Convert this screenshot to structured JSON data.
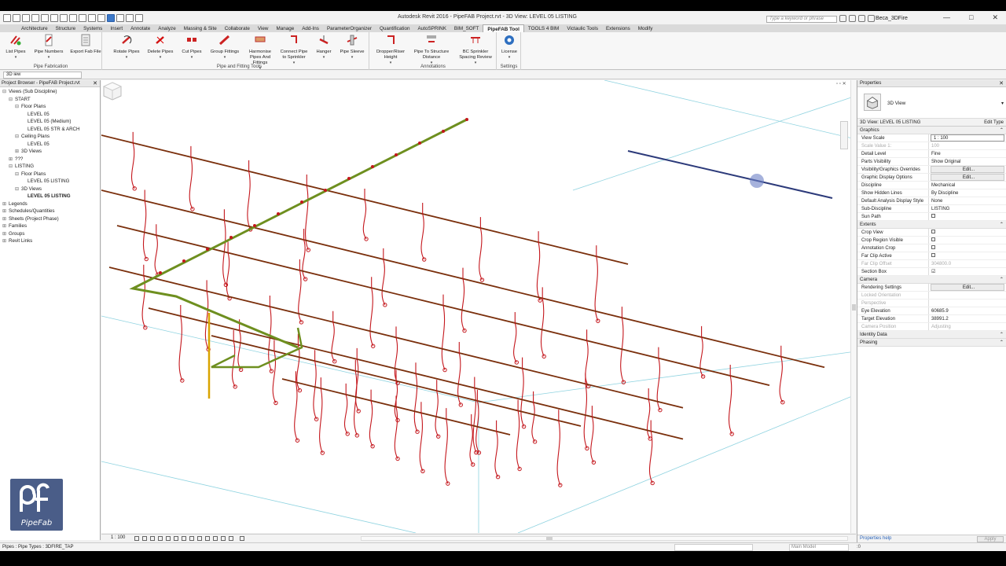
{
  "window": {
    "title": "Autodesk Revit 2016 -    PipeFAB Project.rvt - 3D View: LEVEL 05 LISTING",
    "search_placeholder": "Type a keyword or phrase",
    "user": "Beca_3DFire",
    "controls": [
      "—",
      "□",
      "✕"
    ]
  },
  "ribbon_tabs": [
    {
      "label": "Architecture"
    },
    {
      "label": "Structure"
    },
    {
      "label": "Systems"
    },
    {
      "label": "Insert"
    },
    {
      "label": "Annotate"
    },
    {
      "label": "Analyze"
    },
    {
      "label": "Massing & Site"
    },
    {
      "label": "Collaborate"
    },
    {
      "label": "View"
    },
    {
      "label": "Manage"
    },
    {
      "label": "Add-Ins"
    },
    {
      "label": "ParameterOrganizer"
    },
    {
      "label": "Quantification"
    },
    {
      "label": "AutoSPRINK"
    },
    {
      "label": "BIM_SOFT"
    },
    {
      "label": "PipeFAB Tool",
      "active": true
    },
    {
      "label": "TOOLS 4 BIM"
    },
    {
      "label": "Victaulic Tools"
    },
    {
      "label": "Extensions"
    },
    {
      "label": "Modify"
    }
  ],
  "ribbon_groups": {
    "pipe_fabrication": {
      "label": "Pipe Fabrication",
      "buttons": [
        {
          "label": "List Pipes",
          "dd": "▾"
        },
        {
          "label": "Pipe Numbers",
          "dd": "▾"
        },
        {
          "label": "Export Fab File",
          "dd": ""
        }
      ]
    },
    "pipe_fitting_tools": {
      "label": "Pipe and Fitting Tools",
      "buttons": [
        {
          "label": "Rotate Pipes",
          "dd": "▾"
        },
        {
          "label": "Delete Pipes",
          "dd": "▾"
        },
        {
          "label": "Cut Pipes",
          "dd": "▾"
        },
        {
          "label": "Group Fittings",
          "dd": "▾"
        },
        {
          "label": "Harmonise Pipes And Fittings",
          "dd": "▾"
        },
        {
          "label": "Connect Pipe to Sprinkler",
          "dd": "▾"
        },
        {
          "label": "Hanger",
          "dd": "▾"
        },
        {
          "label": "Pipe Sleeve",
          "dd": "▾"
        }
      ]
    },
    "annotations": {
      "label": "Annotations",
      "buttons": [
        {
          "label": "Dropper/Riser Height",
          "dd": "▾"
        },
        {
          "label": "Pipe To Structure Distance",
          "dd": "▾"
        },
        {
          "label": "BC Sprinkler Spacing Review",
          "dd": "▾"
        }
      ]
    },
    "settings": {
      "label": "Settings",
      "buttons": [
        {
          "label": "License",
          "dd": "▾"
        }
      ]
    }
  },
  "options_bar": {
    "view_selector": "3D    iew"
  },
  "project_browser": {
    "title": "Project Browser - PipeFAB Project.rvt",
    "items": [
      {
        "label": "Views (Sub Discipline)",
        "indent": 0,
        "toggle": "⊟"
      },
      {
        "label": "START",
        "indent": 1,
        "toggle": "⊟"
      },
      {
        "label": "Floor Plans",
        "indent": 2,
        "toggle": "⊟"
      },
      {
        "label": "LEVEL 05",
        "indent": 3,
        "toggle": ""
      },
      {
        "label": "LEVEL 05 (Medium)",
        "indent": 3,
        "toggle": ""
      },
      {
        "label": "LEVEL 05 STR & ARCH",
        "indent": 3,
        "toggle": ""
      },
      {
        "label": "Ceiling Plans",
        "indent": 2,
        "toggle": "⊟"
      },
      {
        "label": "LEVEL 05",
        "indent": 3,
        "toggle": ""
      },
      {
        "label": "3D Views",
        "indent": 2,
        "toggle": "⊞"
      },
      {
        "label": "???",
        "indent": 1,
        "toggle": "⊞"
      },
      {
        "label": "LISTING",
        "indent": 1,
        "toggle": "⊟"
      },
      {
        "label": "Floor Plans",
        "indent": 2,
        "toggle": "⊟"
      },
      {
        "label": "LEVEL 05 LISTING",
        "indent": 3,
        "toggle": ""
      },
      {
        "label": "3D Views",
        "indent": 2,
        "toggle": "⊟"
      },
      {
        "label": "LEVEL 05 LISTING",
        "indent": 3,
        "toggle": "",
        "bold": true
      },
      {
        "label": "Legends",
        "indent": 0,
        "toggle": "⊞"
      },
      {
        "label": "Schedules/Quantities",
        "indent": 0,
        "toggle": "⊞"
      },
      {
        "label": "Sheets (Project Phase)",
        "indent": 0,
        "toggle": "⊞"
      },
      {
        "label": "Families",
        "indent": 0,
        "toggle": "⊞"
      },
      {
        "label": "Groups",
        "indent": 0,
        "toggle": "⊞"
      },
      {
        "label": "Revit Links",
        "indent": 0,
        "toggle": "⊞"
      }
    ]
  },
  "view_control_bar": {
    "scale": "1 : 100"
  },
  "properties": {
    "title": "Properties",
    "type_name": "3D View",
    "instance": "3D View: LEVEL 05 LISTING",
    "edit_type": "Edit Type",
    "sections": [
      {
        "name": "Graphics",
        "rows": [
          {
            "k": "View Scale",
            "v": "1 : 100",
            "kind": "box"
          },
          {
            "k": "Scale Value    1:",
            "v": "100",
            "kind": "dim"
          },
          {
            "k": "Detail Level",
            "v": "Fine"
          },
          {
            "k": "Parts Visibility",
            "v": "Show Original"
          },
          {
            "k": "Visibility/Graphics Overrides",
            "v": "Edit...",
            "kind": "edit"
          },
          {
            "k": "Graphic Display Options",
            "v": "Edit...",
            "kind": "edit"
          },
          {
            "k": "Discipline",
            "v": "Mechanical"
          },
          {
            "k": "Show Hidden Lines",
            "v": "By Discipline"
          },
          {
            "k": "Default Analysis Display Style",
            "v": "None"
          },
          {
            "k": "Sub-Discipline",
            "v": "LISTING"
          },
          {
            "k": "Sun Path",
            "v": "",
            "kind": "check"
          }
        ]
      },
      {
        "name": "Extents",
        "rows": [
          {
            "k": "Crop View",
            "v": "",
            "kind": "check"
          },
          {
            "k": "Crop Region Visible",
            "v": "",
            "kind": "check"
          },
          {
            "k": "Annotation Crop",
            "v": "",
            "kind": "check"
          },
          {
            "k": "Far Clip Active",
            "v": "",
            "kind": "check"
          },
          {
            "k": "Far Clip Offset",
            "v": "304800.0",
            "kind": "dim"
          },
          {
            "k": "Section Box",
            "v": "☑",
            "kind": "plain"
          }
        ]
      },
      {
        "name": "Camera",
        "rows": [
          {
            "k": "Rendering Settings",
            "v": "Edit...",
            "kind": "edit"
          },
          {
            "k": "Locked Orientation",
            "v": "",
            "kind": "dim"
          },
          {
            "k": "Perspective",
            "v": "",
            "kind": "dim"
          },
          {
            "k": "Eye Elevation",
            "v": "60685.9"
          },
          {
            "k": "Target Elevation",
            "v": "38991.2"
          },
          {
            "k": "Camera Position",
            "v": "Adjusting",
            "kind": "dim"
          }
        ]
      },
      {
        "name": "Identity Data",
        "rows": []
      },
      {
        "name": "Phasing",
        "rows": []
      }
    ],
    "help": "Properties help",
    "apply": "Apply"
  },
  "status": {
    "text": "Pipes : Pipe Types : 3DFIRE_TAP",
    "model": "Main Model",
    "filter": ":0"
  },
  "logo": {
    "text": "PipeFab"
  },
  "colors": {
    "pipe_main": "#7a2f0c",
    "pipe_branch_green": "#6e8f1f",
    "drop_red": "#c4161c",
    "selected_blue": "#2c3a7a",
    "riser_yellow": "#d9a400",
    "section_box": "#8fd3e0"
  }
}
